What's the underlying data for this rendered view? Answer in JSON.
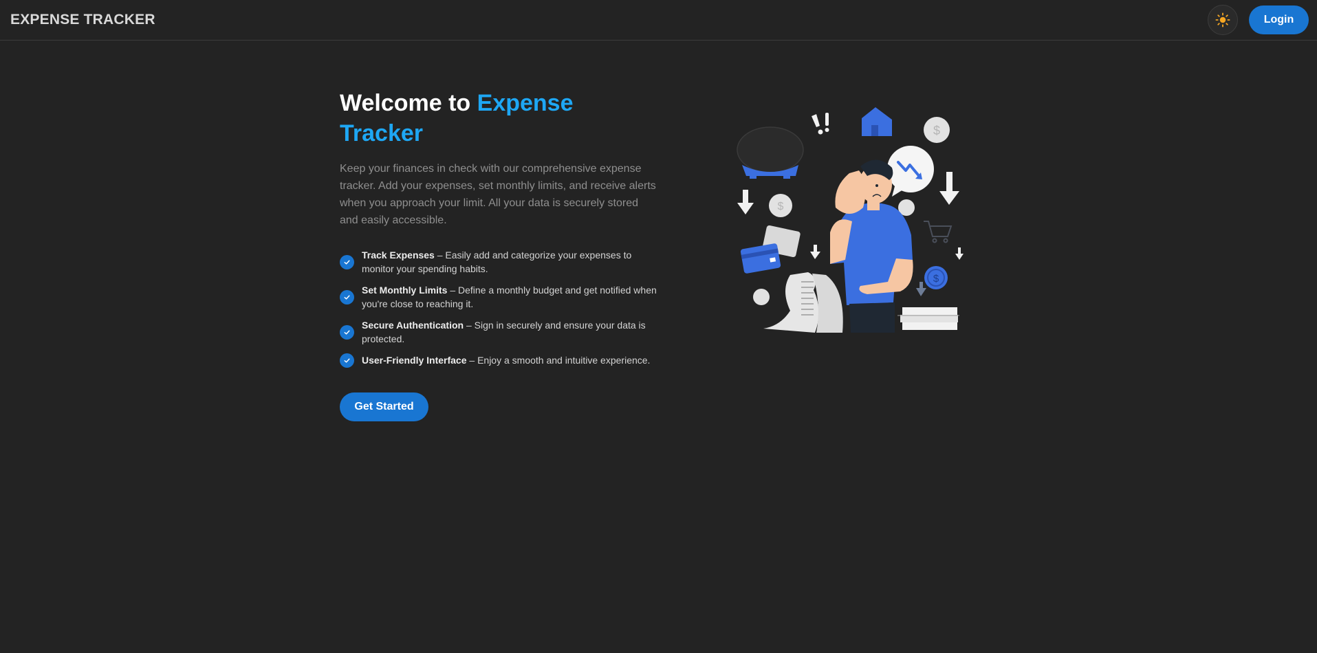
{
  "navbar": {
    "brand": "EXPENSE TRACKER",
    "theme_toggle_icon": "sun-icon",
    "login_label": "Login"
  },
  "hero": {
    "title_prefix": "Welcome to ",
    "title_accent": "Expense Tracker",
    "description": "Keep your finances in check with our comprehensive expense tracker. Add your expenses, set monthly limits, and receive alerts when you approach your limit. All your data is securely stored and easily accessible.",
    "features": [
      {
        "title": "Track Expenses",
        "text": " – Easily add and categorize your expenses to monitor your spending habits."
      },
      {
        "title": "Set Monthly Limits",
        "text": " – Define a monthly budget and get notified when you're close to reaching it."
      },
      {
        "title": "Secure Authentication",
        "text": " – Sign in securely and ensure your data is protected."
      },
      {
        "title": "User-Friendly Interface",
        "text": " – Enjoy a smooth and intuitive experience."
      }
    ],
    "cta_label": "Get Started"
  },
  "colors": {
    "background": "#232323",
    "accent": "#1ea7f4",
    "primary_button": "#1976d2",
    "sun": "#f5a623"
  }
}
